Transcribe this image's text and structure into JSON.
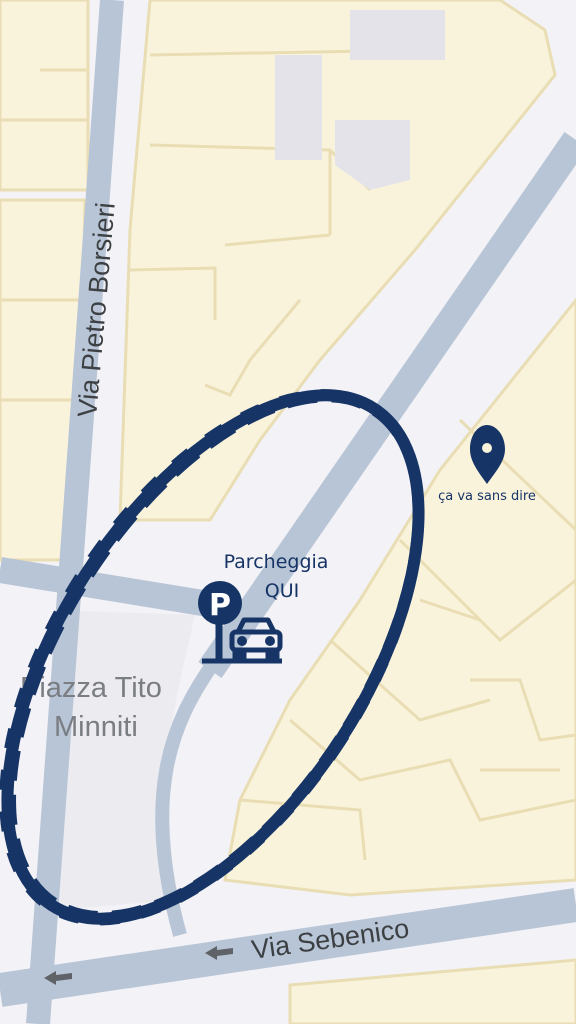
{
  "map": {
    "streets": {
      "via_pietro_borsieri": "Via Pietro Borsieri",
      "via_sebenico": "Via Sebenico"
    },
    "places": {
      "piazza_line1": "Piazza Tito",
      "piazza_line2": "Minniti"
    },
    "annotation": {
      "parking_line1": "Parcheggia",
      "parking_line2": "QUI",
      "parking_symbol": "P",
      "pin_label": "ça va sans dire"
    },
    "icons": {
      "parking": "parking-sign-icon",
      "car": "car-icon",
      "pin": "location-pin-icon",
      "oneway": "one-way-arrow-icon"
    },
    "colors": {
      "background": "#f3f2f6",
      "building_fill": "#faf3dc",
      "building_outline": "#e9ddb4",
      "road": "#b8c5d6",
      "annotation": "#163566"
    }
  }
}
